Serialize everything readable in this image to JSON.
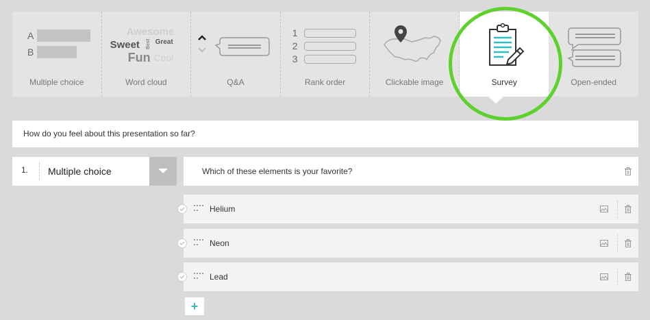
{
  "question_types": [
    {
      "label": "Multiple choice",
      "art": {
        "a": "A",
        "b": "B"
      }
    },
    {
      "label": "Word cloud",
      "art": {
        "w1": "Awesome",
        "w2": "Sweet",
        "w3": "Best",
        "w4": "Great",
        "w5": "Fun",
        "w6": "Cool"
      }
    },
    {
      "label": "Q&A"
    },
    {
      "label": "Rank order",
      "art": {
        "n1": "1",
        "n2": "2",
        "n3": "3"
      }
    },
    {
      "label": "Clickable image"
    },
    {
      "label": "Survey"
    },
    {
      "label": "Open-ended"
    }
  ],
  "selected_type": "Survey",
  "question_title": "How do you feel about this presentation so far?",
  "item": {
    "number": "1.",
    "type_label": "Multiple choice",
    "question": "Which of these elements is your favorite?"
  },
  "options": [
    {
      "label": "Helium"
    },
    {
      "label": "Neon"
    },
    {
      "label": "Lead"
    }
  ],
  "add_label": "+",
  "colors": {
    "accent": "#2fbfc1",
    "highlight_ring": "#5fd12e",
    "background": "#dadada"
  },
  "icons": [
    "chevron-up-icon",
    "chevron-down-icon",
    "map-pin-icon",
    "clipboard-pencil-icon",
    "speech-bubbles-icon",
    "caret-down-icon",
    "trash-icon",
    "image-icon",
    "check-icon",
    "drag-handle-icon",
    "plus-icon"
  ]
}
